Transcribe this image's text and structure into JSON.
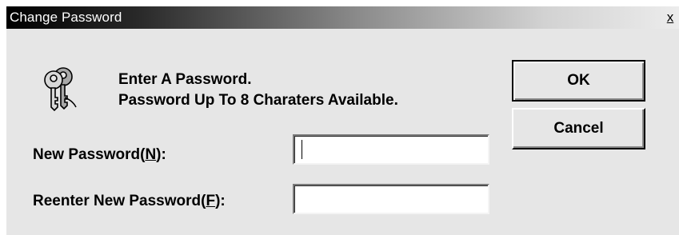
{
  "window": {
    "title": "Change Password",
    "close_label": "x"
  },
  "icons": {
    "keys": "keys-icon",
    "close": "close-icon"
  },
  "prompt": {
    "line1": "Enter A Password.",
    "line2": "Password Up To 8 Charaters Available."
  },
  "fields": {
    "new_password": {
      "label_prefix": "New Password(",
      "hotkey": "N",
      "label_suffix": "):",
      "value": ""
    },
    "reenter_password": {
      "label_prefix": "Reenter New Password(",
      "hotkey": "F",
      "label_suffix": "):",
      "value": ""
    }
  },
  "buttons": {
    "ok_label": "OK",
    "cancel_label": "Cancel"
  },
  "colors": {
    "dialog_background": "#e6e6e6",
    "titlebar_start": "#000000",
    "titlebar_end": "#ececec"
  }
}
